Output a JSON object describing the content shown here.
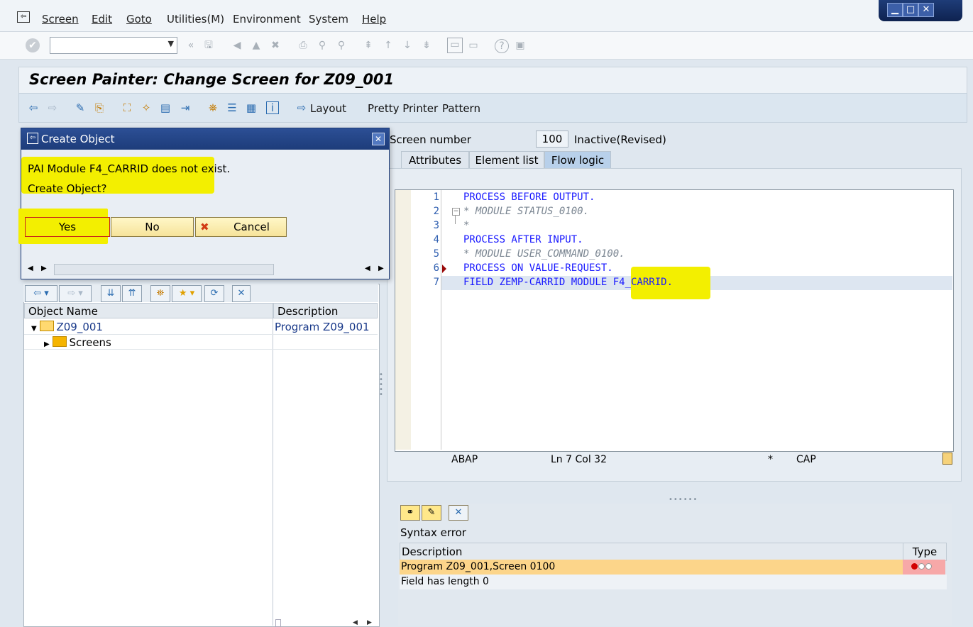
{
  "menubar": {
    "items": [
      "Screen",
      "Edit",
      "Goto",
      "Utilities(M)",
      "Environment",
      "System",
      "Help"
    ]
  },
  "window_controls": {
    "minimize": "▁",
    "maximize": "□",
    "close": "✕"
  },
  "command_field": {
    "value": ""
  },
  "title": "Screen Painter: Change Screen for Z09_001",
  "app_toolbar": {
    "layout_label": "Layout",
    "pretty_printer_label": "Pretty Printer",
    "pattern_label": "Pattern"
  },
  "screen_header": {
    "number_label": "Screen number",
    "number_value": "100",
    "status": "Inactive(Revised)"
  },
  "tabs": [
    "Attributes",
    "Element list",
    "Flow logic"
  ],
  "active_tab": "Flow logic",
  "editor": {
    "line_numbers": [
      "1",
      "2",
      "3",
      "4",
      "5",
      "6",
      "7"
    ],
    "lines": [
      "PROCESS BEFORE OUTPUT.",
      "* MODULE STATUS_0100.",
      "*",
      "PROCESS AFTER INPUT.",
      "* MODULE USER_COMMAND_0100.",
      "PROCESS ON VALUE-REQUEST.",
      "FIELD ZEMP-CARRID MODULE F4_CARRID."
    ],
    "status_lang": "ABAP",
    "status_pos": "Ln  7 Col  32",
    "status_mod": "*",
    "status_caps": "CAP"
  },
  "syntax_panel": {
    "label": "Syntax error",
    "col_description": "Description",
    "col_type": "Type",
    "rows": [
      {
        "description": "Program Z09_001,Screen 0100"
      },
      {
        "description": "Field  has length 0"
      }
    ]
  },
  "tree": {
    "col_name": "Object Name",
    "col_desc": "Description",
    "rows": [
      {
        "name": "Z09_001",
        "desc": "Program Z09_001"
      },
      {
        "name": "Screens",
        "desc": ""
      }
    ]
  },
  "dialog": {
    "title": "Create Object",
    "message": "PAI Module F4_CARRID does not exist.",
    "question": "Create Object?",
    "yes_label": "Yes",
    "no_label": "No",
    "cancel_label": "Cancel"
  },
  "colors": {
    "highlight": "#f3ef00",
    "dialog_title": "#1d3c7a",
    "code_keyword": "#1a1aff",
    "error_row": "#fcd58a"
  }
}
